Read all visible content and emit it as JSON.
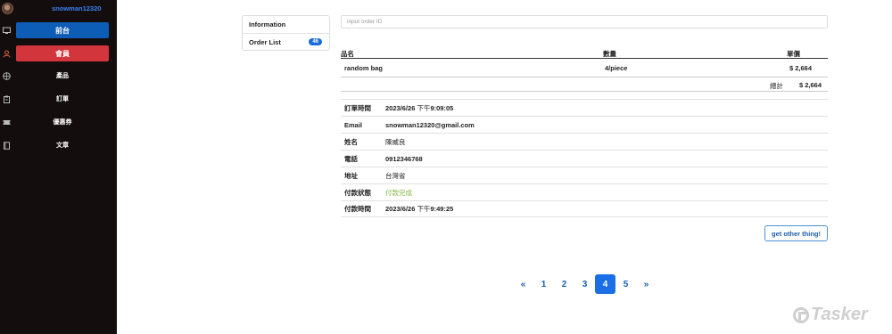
{
  "sidebar": {
    "username": "snowman12320",
    "items": [
      {
        "label": "前台",
        "icon": "monitor-icon"
      },
      {
        "label": "會員",
        "icon": "user-icon"
      },
      {
        "label": "產品",
        "icon": "basketball-icon"
      },
      {
        "label": "訂單",
        "icon": "clipboard-icon"
      },
      {
        "label": "優惠券",
        "icon": "ticket-icon"
      },
      {
        "label": "文章",
        "icon": "book-icon"
      }
    ],
    "colors": {
      "front": "#0d5db7",
      "member": "#d2353b",
      "username": "#3b82f6"
    }
  },
  "panel": {
    "information": "Information",
    "order_list": "Order List",
    "order_count": "46"
  },
  "search": {
    "placeholder": "input order ID"
  },
  "products": {
    "headers": {
      "name": "品名",
      "qty": "數量",
      "price": "單價"
    },
    "rows": [
      {
        "name": "random bag",
        "qty": "4/piece",
        "price": "$ 2,664"
      }
    ],
    "total_label": "總計",
    "total_value": "$ 2,664"
  },
  "details": [
    {
      "label": "訂單時間",
      "value_date": "2023/6/26",
      "value_ampm": "下午",
      "value_time": "9:09:05"
    },
    {
      "label": "Email",
      "value": "snowman12320@gmail.com"
    },
    {
      "label": "姓名",
      "value": "陳威良"
    },
    {
      "label": "電話",
      "value": "0912346768"
    },
    {
      "label": "地址",
      "value": "台灣省"
    },
    {
      "label": "付款狀態",
      "value": "付款完成"
    },
    {
      "label": "付款時間",
      "value_date": "2023/6/26",
      "value_ampm": "下午",
      "value_time": "9:49:25"
    }
  ],
  "other_button": "get other thing!",
  "pagination": {
    "prev": "«",
    "pages": [
      "1",
      "2",
      "3",
      "4",
      "5"
    ],
    "current": "4",
    "next": "»"
  },
  "watermark": "Tasker"
}
